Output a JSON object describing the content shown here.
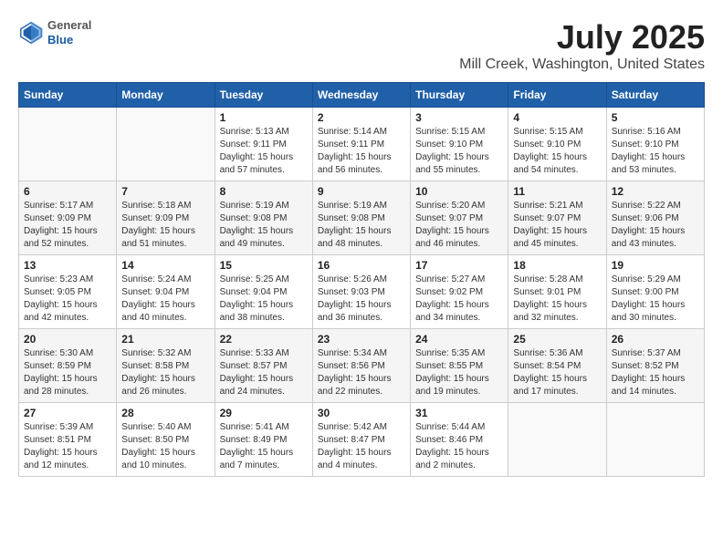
{
  "header": {
    "logo": {
      "general": "General",
      "blue": "Blue"
    },
    "title": "July 2025",
    "subtitle": "Mill Creek, Washington, United States"
  },
  "columns": [
    "Sunday",
    "Monday",
    "Tuesday",
    "Wednesday",
    "Thursday",
    "Friday",
    "Saturday"
  ],
  "weeks": [
    [
      {
        "day": "",
        "sunrise": "",
        "sunset": "",
        "daylight": ""
      },
      {
        "day": "",
        "sunrise": "",
        "sunset": "",
        "daylight": ""
      },
      {
        "day": "1",
        "sunrise": "Sunrise: 5:13 AM",
        "sunset": "Sunset: 9:11 PM",
        "daylight": "Daylight: 15 hours and 57 minutes."
      },
      {
        "day": "2",
        "sunrise": "Sunrise: 5:14 AM",
        "sunset": "Sunset: 9:11 PM",
        "daylight": "Daylight: 15 hours and 56 minutes."
      },
      {
        "day": "3",
        "sunrise": "Sunrise: 5:15 AM",
        "sunset": "Sunset: 9:10 PM",
        "daylight": "Daylight: 15 hours and 55 minutes."
      },
      {
        "day": "4",
        "sunrise": "Sunrise: 5:15 AM",
        "sunset": "Sunset: 9:10 PM",
        "daylight": "Daylight: 15 hours and 54 minutes."
      },
      {
        "day": "5",
        "sunrise": "Sunrise: 5:16 AM",
        "sunset": "Sunset: 9:10 PM",
        "daylight": "Daylight: 15 hours and 53 minutes."
      }
    ],
    [
      {
        "day": "6",
        "sunrise": "Sunrise: 5:17 AM",
        "sunset": "Sunset: 9:09 PM",
        "daylight": "Daylight: 15 hours and 52 minutes."
      },
      {
        "day": "7",
        "sunrise": "Sunrise: 5:18 AM",
        "sunset": "Sunset: 9:09 PM",
        "daylight": "Daylight: 15 hours and 51 minutes."
      },
      {
        "day": "8",
        "sunrise": "Sunrise: 5:19 AM",
        "sunset": "Sunset: 9:08 PM",
        "daylight": "Daylight: 15 hours and 49 minutes."
      },
      {
        "day": "9",
        "sunrise": "Sunrise: 5:19 AM",
        "sunset": "Sunset: 9:08 PM",
        "daylight": "Daylight: 15 hours and 48 minutes."
      },
      {
        "day": "10",
        "sunrise": "Sunrise: 5:20 AM",
        "sunset": "Sunset: 9:07 PM",
        "daylight": "Daylight: 15 hours and 46 minutes."
      },
      {
        "day": "11",
        "sunrise": "Sunrise: 5:21 AM",
        "sunset": "Sunset: 9:07 PM",
        "daylight": "Daylight: 15 hours and 45 minutes."
      },
      {
        "day": "12",
        "sunrise": "Sunrise: 5:22 AM",
        "sunset": "Sunset: 9:06 PM",
        "daylight": "Daylight: 15 hours and 43 minutes."
      }
    ],
    [
      {
        "day": "13",
        "sunrise": "Sunrise: 5:23 AM",
        "sunset": "Sunset: 9:05 PM",
        "daylight": "Daylight: 15 hours and 42 minutes."
      },
      {
        "day": "14",
        "sunrise": "Sunrise: 5:24 AM",
        "sunset": "Sunset: 9:04 PM",
        "daylight": "Daylight: 15 hours and 40 minutes."
      },
      {
        "day": "15",
        "sunrise": "Sunrise: 5:25 AM",
        "sunset": "Sunset: 9:04 PM",
        "daylight": "Daylight: 15 hours and 38 minutes."
      },
      {
        "day": "16",
        "sunrise": "Sunrise: 5:26 AM",
        "sunset": "Sunset: 9:03 PM",
        "daylight": "Daylight: 15 hours and 36 minutes."
      },
      {
        "day": "17",
        "sunrise": "Sunrise: 5:27 AM",
        "sunset": "Sunset: 9:02 PM",
        "daylight": "Daylight: 15 hours and 34 minutes."
      },
      {
        "day": "18",
        "sunrise": "Sunrise: 5:28 AM",
        "sunset": "Sunset: 9:01 PM",
        "daylight": "Daylight: 15 hours and 32 minutes."
      },
      {
        "day": "19",
        "sunrise": "Sunrise: 5:29 AM",
        "sunset": "Sunset: 9:00 PM",
        "daylight": "Daylight: 15 hours and 30 minutes."
      }
    ],
    [
      {
        "day": "20",
        "sunrise": "Sunrise: 5:30 AM",
        "sunset": "Sunset: 8:59 PM",
        "daylight": "Daylight: 15 hours and 28 minutes."
      },
      {
        "day": "21",
        "sunrise": "Sunrise: 5:32 AM",
        "sunset": "Sunset: 8:58 PM",
        "daylight": "Daylight: 15 hours and 26 minutes."
      },
      {
        "day": "22",
        "sunrise": "Sunrise: 5:33 AM",
        "sunset": "Sunset: 8:57 PM",
        "daylight": "Daylight: 15 hours and 24 minutes."
      },
      {
        "day": "23",
        "sunrise": "Sunrise: 5:34 AM",
        "sunset": "Sunset: 8:56 PM",
        "daylight": "Daylight: 15 hours and 22 minutes."
      },
      {
        "day": "24",
        "sunrise": "Sunrise: 5:35 AM",
        "sunset": "Sunset: 8:55 PM",
        "daylight": "Daylight: 15 hours and 19 minutes."
      },
      {
        "day": "25",
        "sunrise": "Sunrise: 5:36 AM",
        "sunset": "Sunset: 8:54 PM",
        "daylight": "Daylight: 15 hours and 17 minutes."
      },
      {
        "day": "26",
        "sunrise": "Sunrise: 5:37 AM",
        "sunset": "Sunset: 8:52 PM",
        "daylight": "Daylight: 15 hours and 14 minutes."
      }
    ],
    [
      {
        "day": "27",
        "sunrise": "Sunrise: 5:39 AM",
        "sunset": "Sunset: 8:51 PM",
        "daylight": "Daylight: 15 hours and 12 minutes."
      },
      {
        "day": "28",
        "sunrise": "Sunrise: 5:40 AM",
        "sunset": "Sunset: 8:50 PM",
        "daylight": "Daylight: 15 hours and 10 minutes."
      },
      {
        "day": "29",
        "sunrise": "Sunrise: 5:41 AM",
        "sunset": "Sunset: 8:49 PM",
        "daylight": "Daylight: 15 hours and 7 minutes."
      },
      {
        "day": "30",
        "sunrise": "Sunrise: 5:42 AM",
        "sunset": "Sunset: 8:47 PM",
        "daylight": "Daylight: 15 hours and 4 minutes."
      },
      {
        "day": "31",
        "sunrise": "Sunrise: 5:44 AM",
        "sunset": "Sunset: 8:46 PM",
        "daylight": "Daylight: 15 hours and 2 minutes."
      },
      {
        "day": "",
        "sunrise": "",
        "sunset": "",
        "daylight": ""
      },
      {
        "day": "",
        "sunrise": "",
        "sunset": "",
        "daylight": ""
      }
    ]
  ]
}
